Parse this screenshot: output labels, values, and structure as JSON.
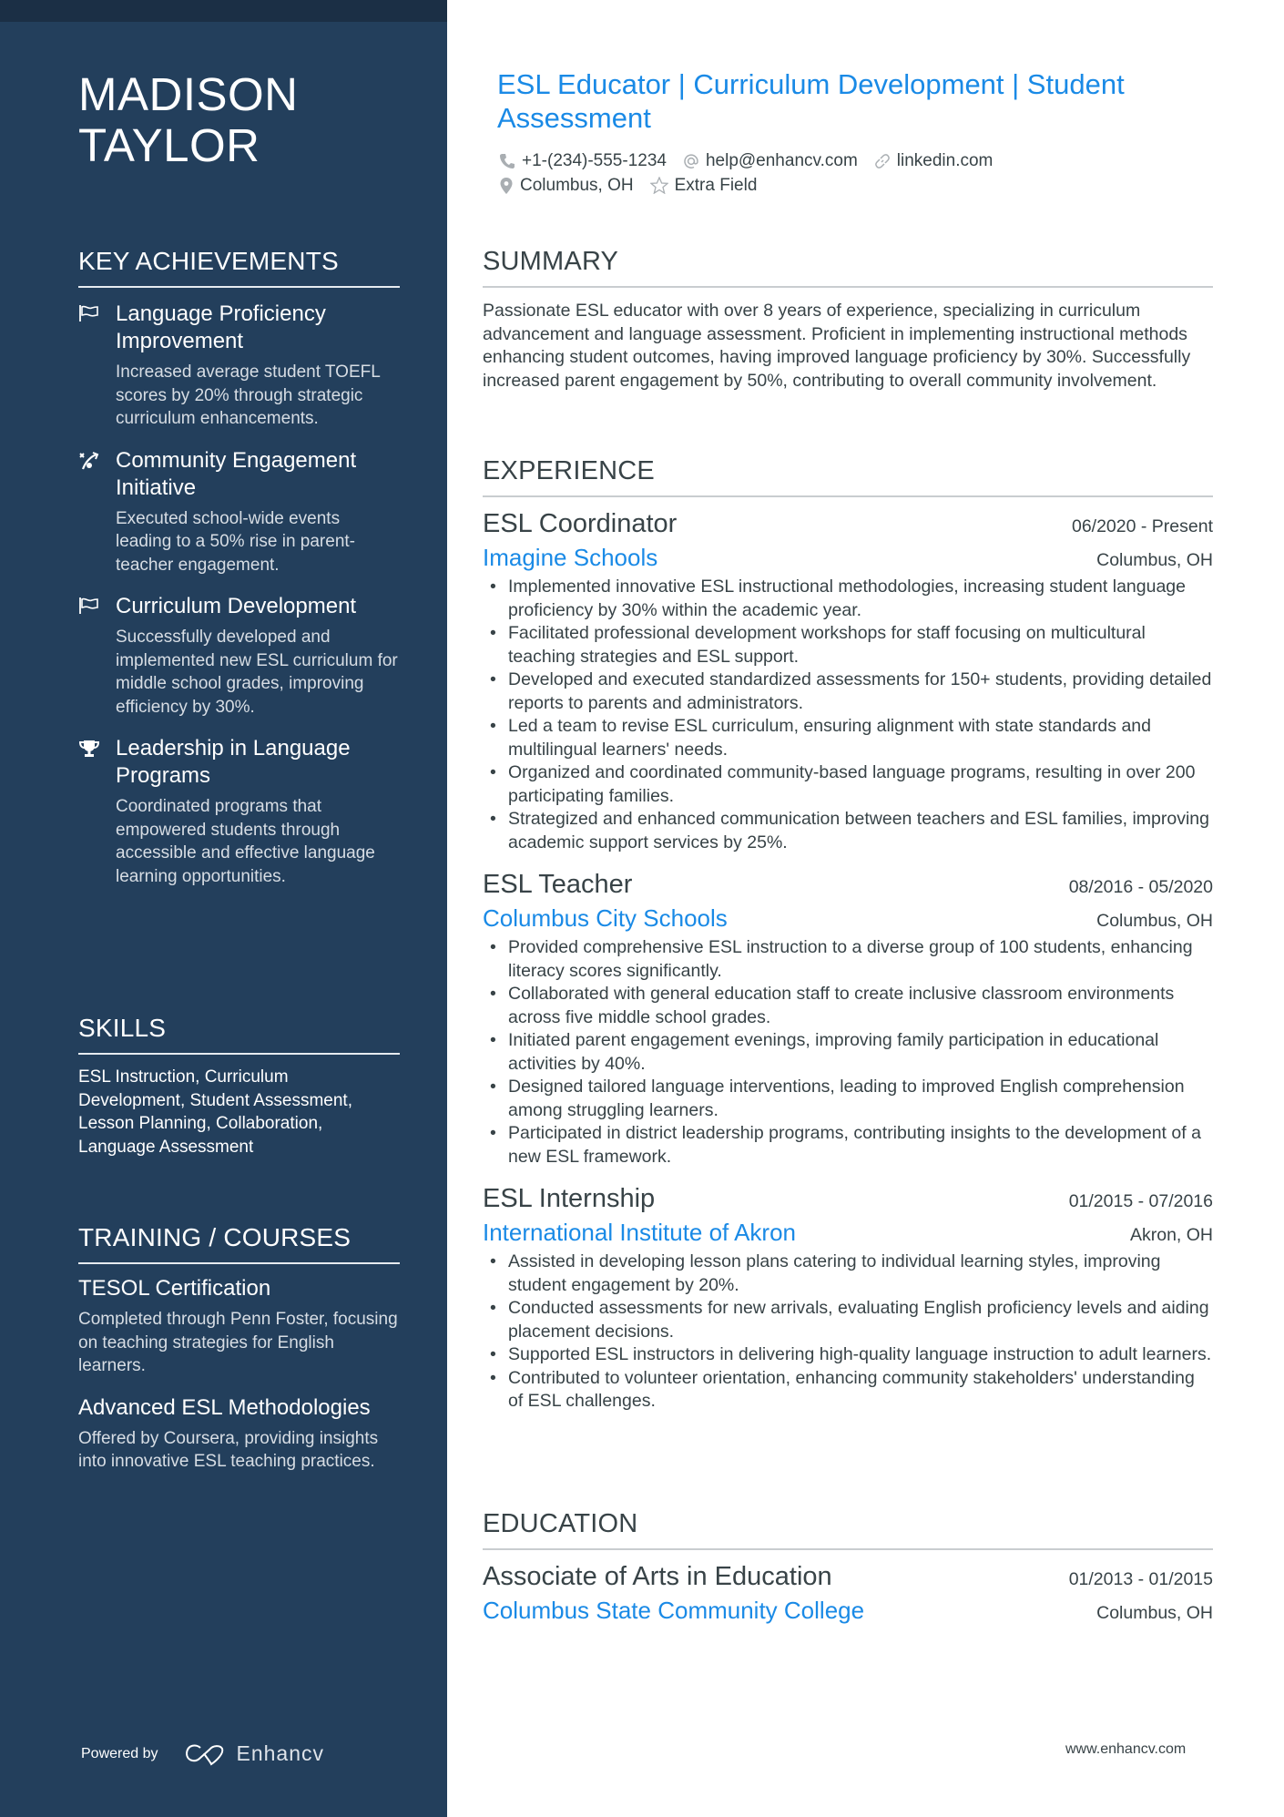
{
  "sidebar": {
    "name_line1": "MADISON",
    "name_line2": "TAYLOR",
    "achievements": {
      "heading": "KEY ACHIEVEMENTS",
      "items": [
        {
          "icon": "flag-icon",
          "title": "Language Proficiency Improvement",
          "desc": "Increased average student TOEFL scores by 20% through strategic curriculum enhancements."
        },
        {
          "icon": "strategy-icon",
          "title": "Community Engagement Initiative",
          "desc": "Executed school-wide events leading to a 50% rise in parent-teacher engagement."
        },
        {
          "icon": "flag-icon",
          "title": "Curriculum Development",
          "desc": "Successfully developed and implemented new ESL curriculum for middle school grades, improving efficiency by 30%."
        },
        {
          "icon": "trophy-icon",
          "title": "Leadership in Language Programs",
          "desc": "Coordinated programs that empowered students through accessible and effective language learning opportunities."
        }
      ]
    },
    "skills": {
      "heading": "SKILLS",
      "text": "ESL Instruction, Curriculum Development, Student Assessment, Lesson Planning, Collaboration, Language Assessment"
    },
    "training": {
      "heading": "TRAINING / COURSES",
      "items": [
        {
          "title": "TESOL Certification",
          "desc": "Completed through Penn Foster, focusing on teaching strategies for English learners."
        },
        {
          "title": "Advanced ESL Methodologies",
          "desc": "Offered by Coursera, providing insights into innovative ESL teaching practices."
        }
      ]
    },
    "footer": {
      "powered_by": "Powered by",
      "brand": "Enhancv"
    }
  },
  "header": {
    "headline": "ESL Educator | Curriculum Development | Student Assessment",
    "contacts": {
      "phone": "+1-(234)-555-1234",
      "email": "help@enhancv.com",
      "link": "linkedin.com",
      "location": "Columbus, OH",
      "extra": "Extra Field"
    }
  },
  "summary": {
    "heading": "SUMMARY",
    "text": "Passionate ESL educator with over 8 years of experience, specializing in curriculum advancement and language assessment. Proficient in implementing instructional methods enhancing student outcomes, having improved language proficiency by 30%. Successfully increased parent engagement by 50%, contributing to overall community involvement."
  },
  "experience": {
    "heading": "EXPERIENCE",
    "jobs": [
      {
        "title": "ESL Coordinator",
        "dates": "06/2020 - Present",
        "company": "Imagine Schools",
        "location": "Columbus, OH",
        "bullets": [
          "Implemented innovative ESL instructional methodologies, increasing student language proficiency by 30% within the academic year.",
          "Facilitated professional development workshops for staff focusing on multicultural teaching strategies and ESL support.",
          "Developed and executed standardized assessments for 150+ students, providing detailed reports to parents and administrators.",
          "Led a team to revise ESL curriculum, ensuring alignment with state standards and multilingual learners' needs.",
          "Organized and coordinated community-based language programs, resulting in over 200 participating families.",
          "Strategized and enhanced communication between teachers and ESL families, improving academic support services by 25%."
        ]
      },
      {
        "title": "ESL Teacher",
        "dates": "08/2016 - 05/2020",
        "company": "Columbus City Schools",
        "location": "Columbus, OH",
        "bullets": [
          "Provided comprehensive ESL instruction to a diverse group of 100 students, enhancing literacy scores significantly.",
          "Collaborated with general education staff to create inclusive classroom environments across five middle school grades.",
          "Initiated parent engagement evenings, improving family participation in educational activities by 40%.",
          "Designed tailored language interventions, leading to improved English comprehension among struggling learners.",
          "Participated in district leadership programs, contributing insights to the development of a new ESL framework."
        ]
      },
      {
        "title": "ESL Internship",
        "dates": "01/2015 - 07/2016",
        "company": "International Institute of Akron",
        "location": "Akron, OH",
        "bullets": [
          "Assisted in developing lesson plans catering to individual learning styles, improving student engagement by 20%.",
          "Conducted assessments for new arrivals, evaluating English proficiency levels and aiding placement decisions.",
          "Supported ESL instructors in delivering high-quality language instruction to adult learners.",
          "Contributed to volunteer orientation, enhancing community stakeholders' understanding of ESL challenges."
        ]
      }
    ]
  },
  "education": {
    "heading": "EDUCATION",
    "items": [
      {
        "degree": "Associate of Arts in Education",
        "dates": "01/2013 - 01/2015",
        "school": "Columbus State Community College",
        "location": "Columbus, OH"
      }
    ]
  },
  "footer": {
    "website": "www.enhancv.com"
  },
  "colors": {
    "sidebar": "#233f5c",
    "sidebar_topband": "#1b2f45",
    "accent": "#1a8ae6",
    "text": "#384347"
  }
}
